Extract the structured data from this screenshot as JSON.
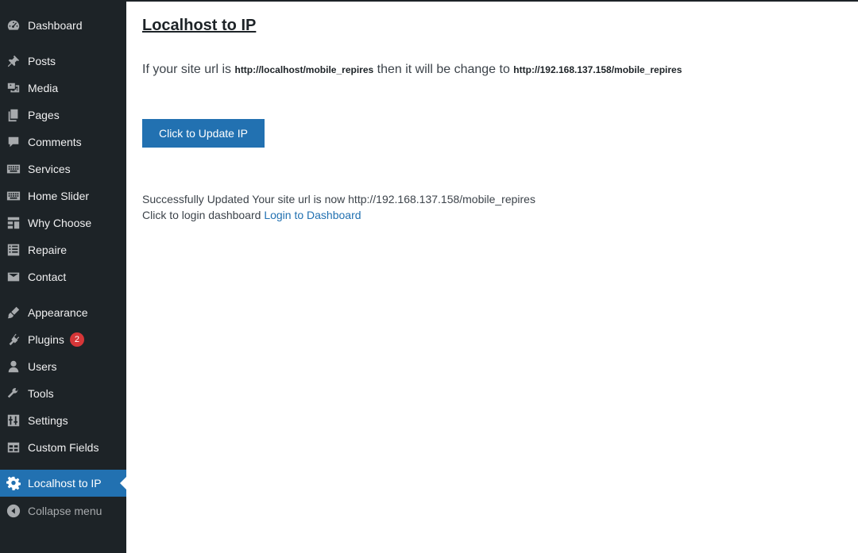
{
  "sidebar": {
    "items": [
      {
        "label": "Dashboard",
        "icon": "dashboard-icon"
      },
      {
        "label": "Posts",
        "icon": "pin-icon"
      },
      {
        "label": "Media",
        "icon": "media-icon"
      },
      {
        "label": "Pages",
        "icon": "pages-icon"
      },
      {
        "label": "Comments",
        "icon": "comment-icon"
      },
      {
        "label": "Services",
        "icon": "keyboard-icon"
      },
      {
        "label": "Home Slider",
        "icon": "keyboard-icon"
      },
      {
        "label": "Why Choose",
        "icon": "layout-icon"
      },
      {
        "label": "Repaire",
        "icon": "list-icon"
      },
      {
        "label": "Contact",
        "icon": "email-icon"
      },
      {
        "label": "Appearance",
        "icon": "brush-icon"
      },
      {
        "label": "Plugins",
        "icon": "plugin-icon",
        "badge": "2"
      },
      {
        "label": "Users",
        "icon": "user-icon"
      },
      {
        "label": "Tools",
        "icon": "wrench-icon"
      },
      {
        "label": "Settings",
        "icon": "settings-icon"
      },
      {
        "label": "Custom Fields",
        "icon": "table-icon"
      },
      {
        "label": "Localhost to IP",
        "icon": "gear-icon"
      },
      {
        "label": "Collapse menu",
        "icon": "collapse-icon"
      }
    ]
  },
  "main": {
    "title": "Localhost to IP",
    "intro_prefix": "If your site url is ",
    "local_url": "http://localhost/mobile_repires",
    "intro_mid": " then it will be change to ",
    "ip_url": "http://192.168.137.158/mobile_repires",
    "button_label": "Click to Update IP",
    "success_text": "Successfully Updated Your site url is now http://192.168.137.158/mobile_repires",
    "login_prefix": "Click to login dashboard ",
    "login_link": "Login to Dashboard"
  },
  "colors": {
    "sidebar_bg": "#1d2327",
    "accent": "#2271b1",
    "badge": "#d63638"
  }
}
